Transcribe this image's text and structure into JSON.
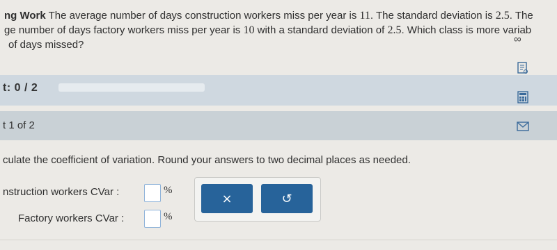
{
  "question": {
    "title": "ng Work",
    "line1": "The average number of days construction workers miss per year is",
    "value_construction_mean": "11",
    "line1b": ". The standard deviation is",
    "value_construction_sd": "2.5",
    "line1c": ". The",
    "line2": "ge number of days factory workers miss per year is",
    "value_factory_mean": "10",
    "line2b": "with a standard deviation of",
    "value_factory_sd": "2.5",
    "line2c": ". Which class is more variab",
    "line3": "of days missed?"
  },
  "icons": {
    "infinity": "∞",
    "notes": "notes-icon",
    "calculator": "calculator-icon",
    "mail": "mail-icon"
  },
  "score": {
    "label": "t: 0 / 2",
    "progress_fraction": 0
  },
  "part": {
    "label": "t 1 of 2"
  },
  "instruction": "culate the coefficient of variation. Round your answers to two decimal places as needed.",
  "answers": {
    "construction_label": "nstruction workers CVar :",
    "factory_label": "Factory workers CVar :",
    "construction_value": "",
    "factory_value": "",
    "unit": "%"
  },
  "buttons": {
    "clear": "×",
    "undo": "↺"
  },
  "colors": {
    "band_blue": "#cfd8e0",
    "band_gray": "#c9d1d6",
    "button": "#27639a"
  }
}
